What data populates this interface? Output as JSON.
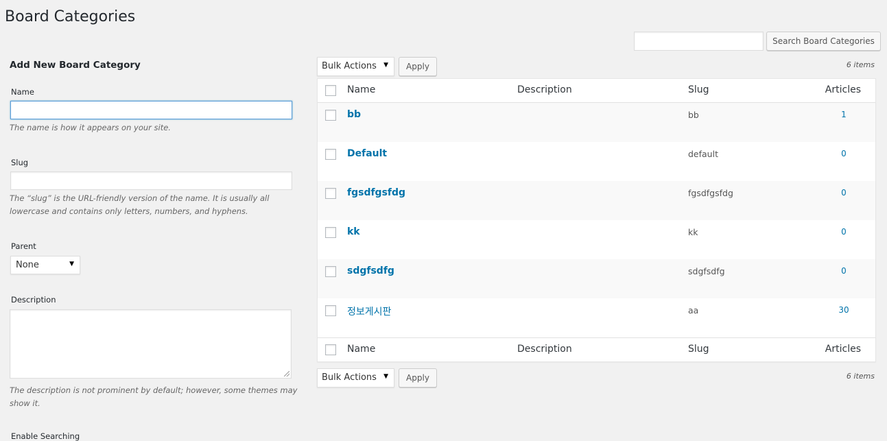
{
  "page": {
    "title": "Board Categories"
  },
  "search": {
    "value": "",
    "button_label": "Search Board Categories"
  },
  "form": {
    "heading": "Add New Board Category",
    "name_label": "Name",
    "name_value": "",
    "name_hint": "The name is how it appears on your site.",
    "slug_label": "Slug",
    "slug_value": "",
    "slug_hint": "The “slug” is the URL-friendly version of the name. It is usually all lowercase and contains only letters, numbers, and hyphens.",
    "parent_label": "Parent",
    "parent_selected": "None",
    "description_label": "Description",
    "description_hint": "The description is not prominent by default; however, some themes may show it.",
    "next_label": "Enable Searching"
  },
  "tablenav": {
    "bulk_actions": "Bulk Actions",
    "apply_label": "Apply",
    "items_count": "6 items"
  },
  "table": {
    "columns": {
      "name": "Name",
      "description": "Description",
      "slug": "Slug",
      "articles": "Articles"
    },
    "rows": [
      {
        "name": "bb",
        "slug": "bb",
        "articles": "1"
      },
      {
        "name": "Default",
        "slug": "default",
        "articles": "0"
      },
      {
        "name": "fgsdfgsfdg",
        "slug": "fgsdfgsfdg",
        "articles": "0"
      },
      {
        "name": "kk",
        "slug": "kk",
        "articles": "0"
      },
      {
        "name": "sdgfsdfg",
        "slug": "sdgfsdfg",
        "articles": "0"
      },
      {
        "name": "정보게시판",
        "slug": "aa",
        "articles": "30"
      }
    ]
  },
  "icons": {
    "dropdown_arrow": "▼"
  }
}
